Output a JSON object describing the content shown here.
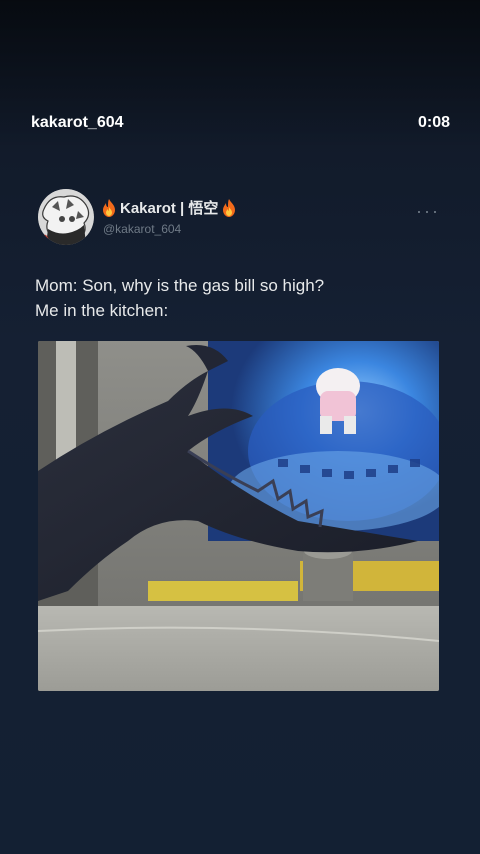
{
  "header": {
    "username": "kakarot_604",
    "timer": "0:08"
  },
  "tweet": {
    "display_name": "Kakarot | 悟空",
    "handle": "@kakarot_604",
    "more_label": "···",
    "text_line1": "Mom: Son, why is the gas bill so high?",
    "text_line2": "Me in the kitchen:",
    "icons": {
      "fire": "fire-icon",
      "more": "more-options-icon"
    }
  },
  "colors": {
    "background": "#131b2a",
    "text_primary": "#e7e9ea",
    "text_secondary": "#6f7a86",
    "flame_blue": "#3a7bd5"
  }
}
